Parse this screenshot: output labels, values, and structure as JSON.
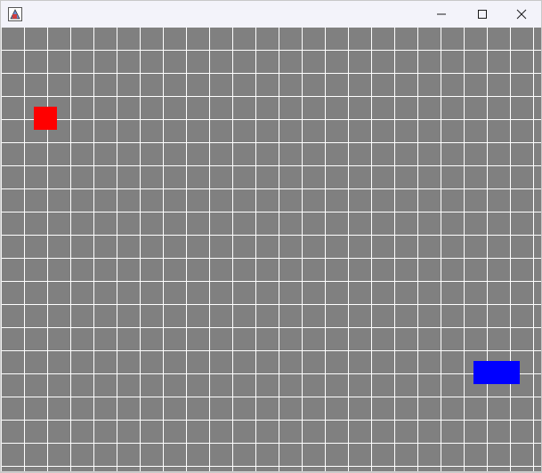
{
  "window": {
    "title": "",
    "icon": "java-app-icon",
    "controls": [
      "minimize-icon",
      "maximize-icon",
      "close-icon"
    ]
  },
  "game": {
    "grid": {
      "columns": 24,
      "rows": 20,
      "background_color": "#808080",
      "line_color": "#ffffff"
    },
    "player": {
      "color": "#ff0000",
      "col": 1,
      "row": 3,
      "width_cells": 1,
      "height_cells": 1
    },
    "target": {
      "color": "#0000ff",
      "col": 20,
      "row": 14,
      "width_cells": 2,
      "height_cells": 1
    }
  }
}
